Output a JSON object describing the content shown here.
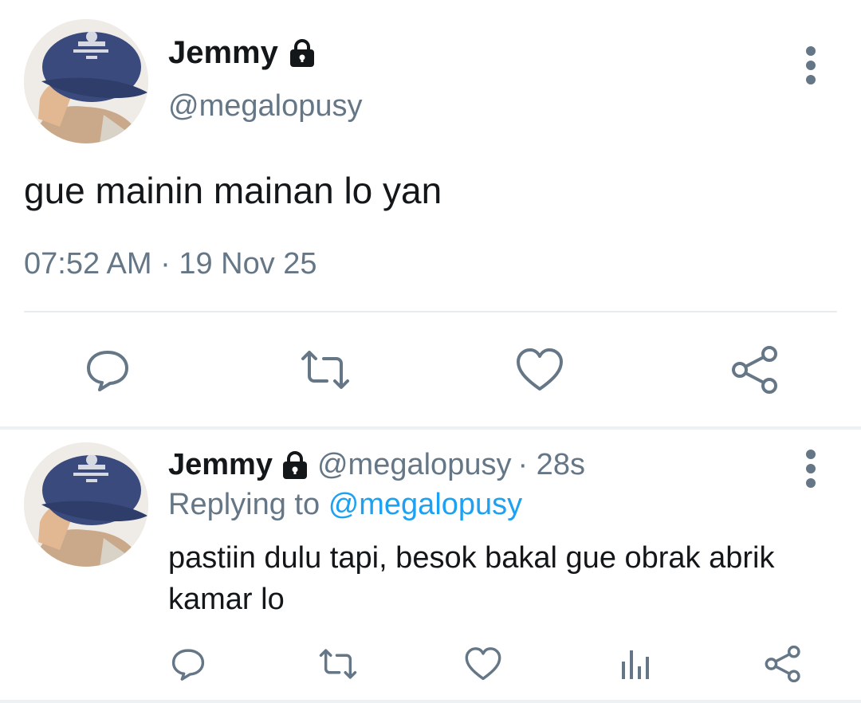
{
  "main_tweet": {
    "name": "Jemmy",
    "handle": "@megalopusy",
    "text": "gue mainin mainan lo yan",
    "timestamp": "07:52 AM · 19 Nov 25",
    "actions": [
      "reply-icon",
      "retweet-icon",
      "like-icon",
      "share-icon"
    ]
  },
  "reply_tweet": {
    "name": "Jemmy",
    "handle": "@megalopusy",
    "time_ago": "· 28s",
    "replying_prefix": "Replying to",
    "replying_to": "@megalopusy",
    "text": "pastiin dulu tapi, besok bakal gue obrak abrik kamar lo",
    "actions": [
      "reply-icon",
      "retweet-icon",
      "like-icon",
      "analytics-icon",
      "share-icon"
    ]
  },
  "colors": {
    "text_primary": "#14171a",
    "text_secondary": "#657786",
    "link": "#1da1f2",
    "divider": "#e6ecf0"
  }
}
